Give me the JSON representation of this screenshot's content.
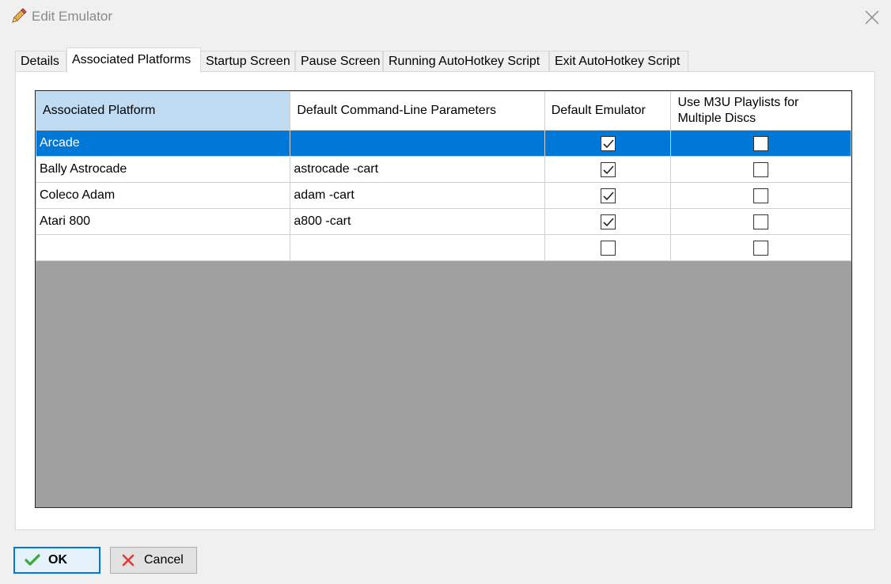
{
  "window": {
    "title": "Edit Emulator",
    "icon": "pencil-icon"
  },
  "tabs": [
    {
      "label": "Details",
      "active": false
    },
    {
      "label": "Associated Platforms",
      "active": true
    },
    {
      "label": "Startup Screen",
      "active": false
    },
    {
      "label": "Pause Screen",
      "active": false
    },
    {
      "label": "Running AutoHotkey Script",
      "active": false
    },
    {
      "label": "Exit AutoHotkey Script",
      "active": false
    }
  ],
  "grid": {
    "columns": [
      "Associated Platform",
      "Default Command-Line Parameters",
      "Default Emulator",
      "Use M3U Playlists for Multiple Discs"
    ],
    "rows": [
      {
        "platform": "Arcade",
        "params": "",
        "default_emulator": true,
        "use_m3u": false,
        "selected": true
      },
      {
        "platform": "Bally Astrocade",
        "params": "astrocade -cart",
        "default_emulator": true,
        "use_m3u": false,
        "selected": false
      },
      {
        "platform": "Coleco Adam",
        "params": "adam -cart",
        "default_emulator": true,
        "use_m3u": false,
        "selected": false
      },
      {
        "platform": "Atari 800",
        "params": "a800 -cart",
        "default_emulator": true,
        "use_m3u": false,
        "selected": false
      },
      {
        "platform": "",
        "params": "",
        "default_emulator": false,
        "use_m3u": false,
        "selected": false
      }
    ]
  },
  "buttons": {
    "ok_label": "OK",
    "cancel_label": "Cancel"
  },
  "colors": {
    "selection": "#0078d7",
    "header_highlight": "#bfdcf3",
    "empty_area": "#a0a0a0"
  }
}
